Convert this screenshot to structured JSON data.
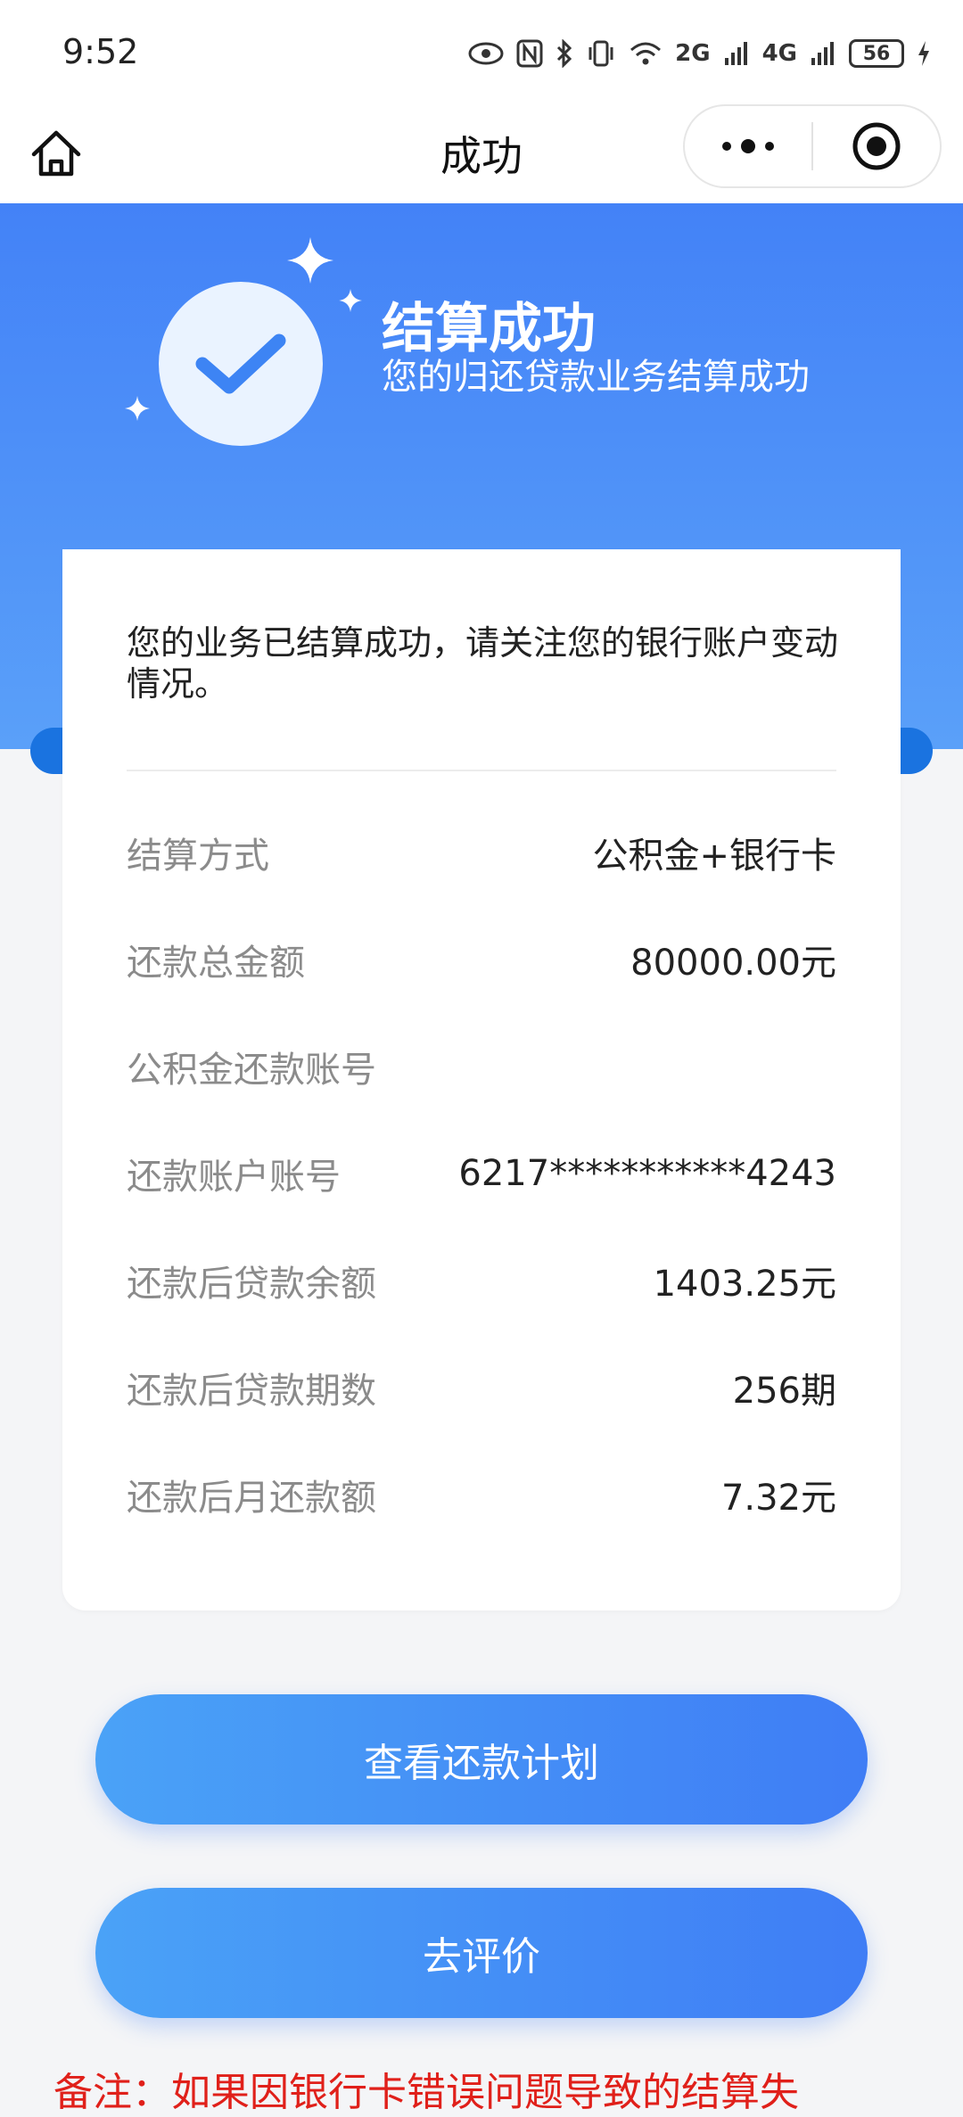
{
  "status_bar": {
    "time": "9:52",
    "net_2g": "2G",
    "net_4g": "4G",
    "battery": "56"
  },
  "nav": {
    "title": "成功"
  },
  "hero": {
    "title": "结算成功",
    "subtitle": "您的归还贷款业务结算成功"
  },
  "card": {
    "message": "您的业务已结算成功，请关注您的银行账户变动情况。",
    "rows": [
      {
        "label": "结算方式",
        "value": "公积金+银行卡"
      },
      {
        "label": "还款总金额",
        "value": "80000.00元"
      },
      {
        "label": "公积金还款账号",
        "value": ""
      },
      {
        "label": "还款账户账号",
        "value": "6217***********4243"
      },
      {
        "label": "还款后贷款余额",
        "value": "1403.25元"
      },
      {
        "label": "还款后贷款期数",
        "value": "256期"
      },
      {
        "label": "还款后月还款额",
        "value": "7.32元"
      }
    ]
  },
  "buttons": {
    "view_plan": "查看还款计划",
    "rate": "去评价"
  },
  "note": "备注：如果因银行卡错误问题导致的结算失",
  "colors": {
    "primary": "#3f7df5",
    "hero_top": "#4382f7",
    "note_red": "#e0201a"
  }
}
